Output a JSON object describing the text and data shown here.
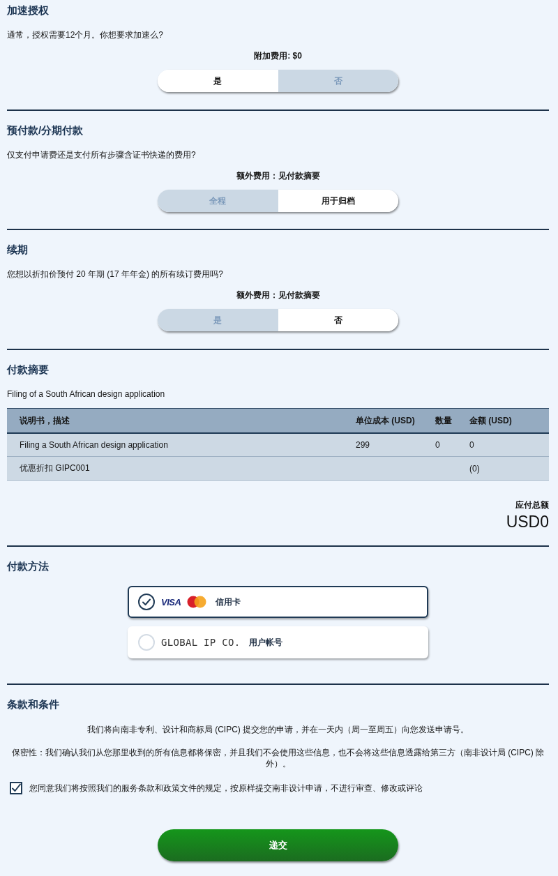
{
  "toggle_sections": [
    {
      "title": "加速授权",
      "question": "通常，授权需要12个月。你想要求加速么?",
      "fee": "附加费用: $0",
      "options": [
        {
          "label": "是",
          "selected": true
        },
        {
          "label": "否",
          "selected": false
        }
      ]
    },
    {
      "title": "预付款/分期付款",
      "question": "仅支付申请费还是支付所有步骤含证书快递的费用?",
      "fee": "额外费用：见付款摘要",
      "options": [
        {
          "label": "全程",
          "selected": false
        },
        {
          "label": "用于归档",
          "selected": true
        }
      ]
    },
    {
      "title": "续期",
      "question": "您想以折扣价预付 20 年期 (17 年年金) 的所有续订费用吗?",
      "fee": "额外费用：见付款摘要",
      "options": [
        {
          "label": "是",
          "selected": false
        },
        {
          "label": "否",
          "selected": true
        }
      ]
    }
  ],
  "payment_summary": {
    "title": "付款摘要",
    "description": "Filing of a South African design application",
    "table": {
      "columns": [
        "说明书，描述",
        "单位成本 (USD)",
        "数量",
        "金额 (USD)"
      ],
      "rows": [
        {
          "description": "Filing a South African design application",
          "unit_cost": "299",
          "quantity": "0",
          "amount": "0"
        },
        {
          "description": "优惠折扣 GIPC001",
          "amount": "(0)"
        }
      ]
    },
    "total_label": "应付总额",
    "total": "USD0"
  },
  "payment_method": {
    "title": "付款方法",
    "options": [
      {
        "kind": "card",
        "brand": "VISA",
        "label": "信用卡",
        "selected": true
      },
      {
        "kind": "account",
        "logo": "GLOBAL IP CO.",
        "label": "用户帐号",
        "selected": false
      }
    ]
  },
  "terms": {
    "title": "条款和条件",
    "paragraphs": [
      "我们将向南非专利、设计和商标局 (CIPC) 提交您的申请，并在一天内（周一至周五）向您发送申请号。",
      "保密性：我们确认我们从您那里收到的所有信息都将保密，并且我们不会使用这些信息，也不会将这些信息透露给第三方（南非设计局 (CIPC) 除外）。"
    ],
    "agreement": {
      "label": "您同意我们将按照我们的服务条款和政策文件的规定，按原样提交南非设计申请，不进行审查、修改或评论",
      "checked": true
    }
  },
  "submit_button": "递交"
}
